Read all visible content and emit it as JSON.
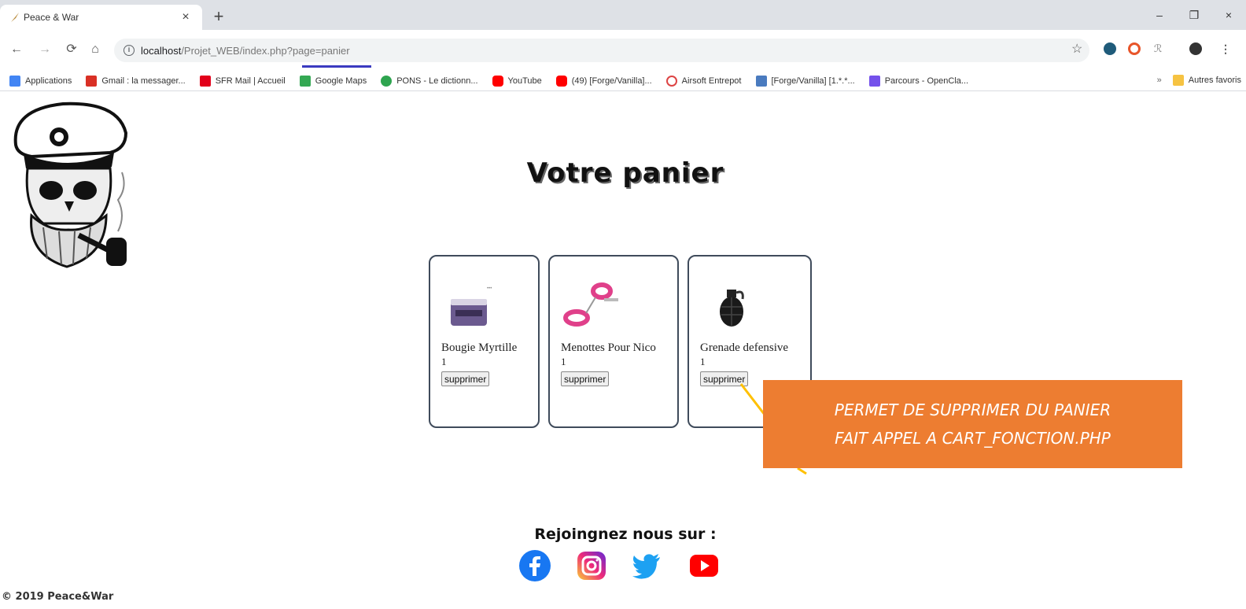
{
  "browser": {
    "tab_title": "Peace & War",
    "tab_close": "×",
    "new_tab": "+",
    "window_minimize": "–",
    "window_maximize": "❐",
    "window_close": "×",
    "url_host": "localhost",
    "url_path": "/Projet_WEB/index.php?page=panier"
  },
  "bookmarks": {
    "items": [
      {
        "label": "Applications",
        "color": "#4285f4"
      },
      {
        "label": "Gmail : la messager...",
        "color": "#d93025"
      },
      {
        "label": "SFR Mail | Accueil",
        "color": "#e2001a"
      },
      {
        "label": "Google Maps",
        "color": "#34a853"
      },
      {
        "label": "PONS - Le dictionn...",
        "color": "#2ea44f"
      },
      {
        "label": "YouTube",
        "color": "#ff0000"
      },
      {
        "label": "(49) [Forge/Vanilla]...",
        "color": "#ff0000"
      },
      {
        "label": "Airsoft Entrepot",
        "color": "#d44"
      },
      {
        "label": "[Forge/Vanilla] [1.*.*...",
        "color": "#4a7bbf"
      },
      {
        "label": "Parcours - OpenCla...",
        "color": "#7451eb"
      }
    ],
    "more": "»",
    "other_favorites": "Autres favoris"
  },
  "page": {
    "title": "Votre panier",
    "social_title": "Rejoingnez nous sur :",
    "copyright": "© 2019 Peace&War"
  },
  "cart": {
    "items": [
      {
        "name": "Bougie Myrtille",
        "qty": "1",
        "button": "supprimer"
      },
      {
        "name": "Menottes Pour Nico",
        "qty": "1",
        "button": "supprimer"
      },
      {
        "name": "Grenade defensive",
        "qty": "1",
        "button": "supprimer"
      }
    ]
  },
  "callout": {
    "line1": "PERMET DE SUPPRIMER DU PANIER",
    "line2": "FAIT APPEL A CART_FONCTION.PHP",
    "color": "#ed7d31"
  },
  "social": {
    "facebook_color": "#1877f2",
    "twitter_color": "#1da1f2",
    "youtube_color": "#ff0000"
  }
}
